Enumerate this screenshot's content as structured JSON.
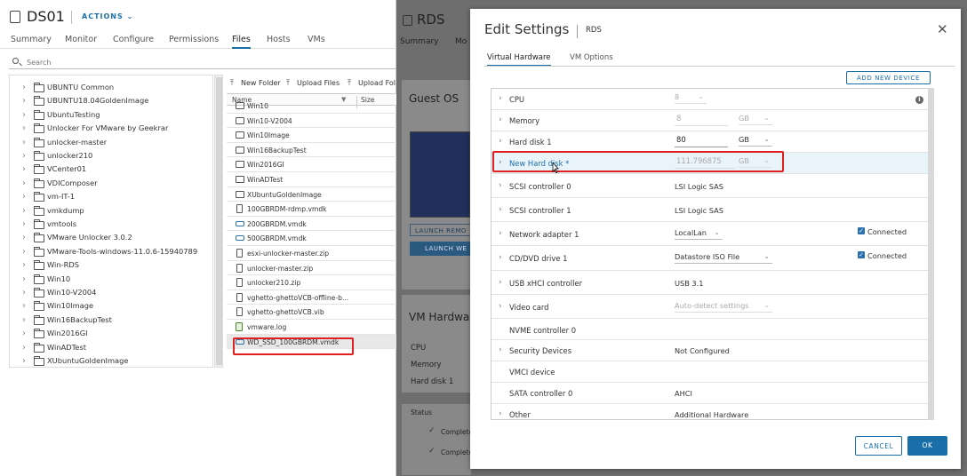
{
  "datastore": {
    "title": "DS01",
    "actions_label": "ACTIONS",
    "tabs": [
      "Summary",
      "Monitor",
      "Configure",
      "Permissions",
      "Files",
      "Hosts",
      "VMs"
    ],
    "active_tab": "Files",
    "search_placeholder": "Search",
    "tree_items": [
      "UBUNTU Common",
      "UBUNTU18.04GoldenImage",
      "UbuntuTesting",
      "Unlocker For VMware by Geekrar",
      "unlocker-master",
      "unlocker210",
      "VCenter01",
      "VDIComposer",
      "vm-IT-1",
      "vmkdump",
      "vmtools",
      "VMware Unlocker 3.0.2",
      "VMware-Tools-windows-11.0.6-15940789",
      "Win-RDS",
      "Win10",
      "Win10-V2004",
      "Win10Image",
      "Win16BackupTest",
      "Win2016GI",
      "WinADTest",
      "XUbuntuGoldenImage"
    ],
    "toolbar": {
      "new_folder": "New Folder",
      "upload_files": "Upload Files",
      "upload_folder": "Upload Fol"
    },
    "columns": {
      "name": "Name",
      "size": "Size"
    },
    "files": [
      {
        "name": "Win10",
        "type": "folder"
      },
      {
        "name": "Win10-V2004",
        "type": "folder"
      },
      {
        "name": "Win10Image",
        "type": "folder"
      },
      {
        "name": "Win16BackupTest",
        "type": "folder"
      },
      {
        "name": "Win2016GI",
        "type": "folder"
      },
      {
        "name": "WinADTest",
        "type": "folder"
      },
      {
        "name": "XUbuntuGoldenImage",
        "type": "folder"
      },
      {
        "name": "100GBRDM-rdmp.vmdk",
        "type": "doc"
      },
      {
        "name": "200GBRDM.vmdk",
        "type": "disk"
      },
      {
        "name": "500GBRDM.vmdk",
        "type": "disk"
      },
      {
        "name": "esxi-unlocker-master.zip",
        "type": "doc"
      },
      {
        "name": "unlocker-master.zip",
        "type": "doc"
      },
      {
        "name": "unlocker210.zip",
        "type": "doc"
      },
      {
        "name": "vghetto-ghettoVCB-offline-b...",
        "type": "doc"
      },
      {
        "name": "vghetto-ghettoVCB.vib",
        "type": "doc"
      },
      {
        "name": "vmware.log",
        "type": "log"
      },
      {
        "name": "WD_SSD_100GBRDM.vmdk",
        "type": "disk"
      }
    ]
  },
  "vm_background": {
    "title": "RDS",
    "tab_summary": "Summary",
    "tab_monitor": "Mo",
    "guest_os_label": "Guest OS",
    "launch_remote": "LAUNCH REMO",
    "launch_web": "LAUNCH WE",
    "vm_hardware_label": "VM Hardwa",
    "hw_cpu": "CPU",
    "hw_memory": "Memory",
    "hw_disk": "Hard disk 1",
    "status_header": "Status",
    "status_1": "Complete",
    "status_2": "Complete"
  },
  "modal": {
    "title": "Edit Settings",
    "vm_name": "RDS",
    "tabs": [
      "Virtual Hardware",
      "VM Options"
    ],
    "active_tab": "Virtual Hardware",
    "add_device": "ADD NEW DEVICE",
    "cancel": "CANCEL",
    "ok": "OK",
    "rows": {
      "cpu": {
        "label": "CPU",
        "value": "8"
      },
      "memory": {
        "label": "Memory",
        "value": "8",
        "unit": "GB"
      },
      "hd1": {
        "label": "Hard disk 1",
        "value": "80",
        "unit": "GB"
      },
      "newhd": {
        "label": "New Hard disk *",
        "value": "111.796875",
        "unit": "GB"
      },
      "scsi0": {
        "label": "SCSI controller 0",
        "value": "LSI Logic SAS"
      },
      "scsi1": {
        "label": "SCSI controller 1",
        "value": "LSI Logic SAS"
      },
      "net": {
        "label": "Network adapter 1",
        "value": "LocalLan",
        "connected": "Connected"
      },
      "cd": {
        "label": "CD/DVD drive 1",
        "value": "Datastore ISO File",
        "connected": "Connected"
      },
      "usb": {
        "label": "USB xHCI controller",
        "value": "USB 3.1"
      },
      "video": {
        "label": "Video card",
        "value": "Auto-detect settings"
      },
      "nvme": {
        "label": "NVME controller 0"
      },
      "sec": {
        "label": "Security Devices",
        "value": "Not Configured"
      },
      "vmci": {
        "label": "VMCI device"
      },
      "sata": {
        "label": "SATA controller 0",
        "value": "AHCI"
      },
      "other": {
        "label": "Other",
        "value": "Additional Hardware"
      }
    }
  },
  "colors": {
    "accent": "#1a6fa8",
    "highlight": "#e02020",
    "overlay": "#6e6e6e"
  }
}
